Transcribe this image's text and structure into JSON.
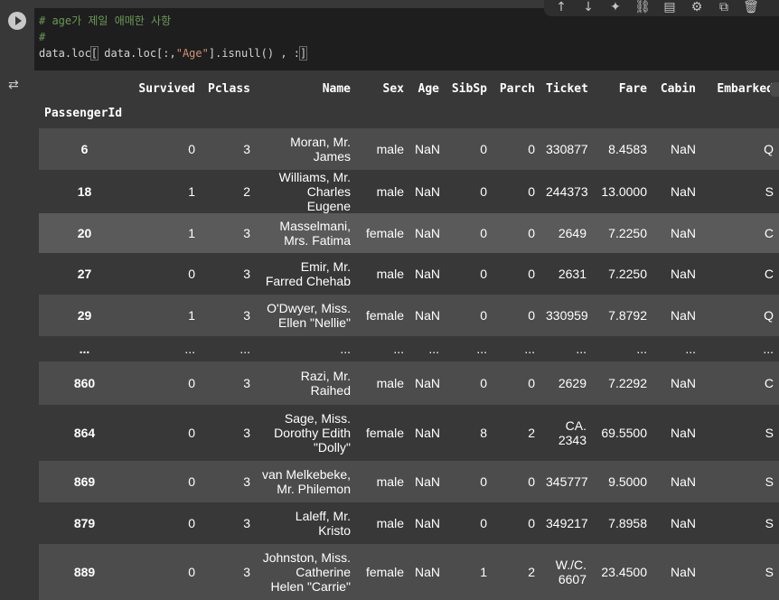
{
  "cell": {
    "code_lines": [
      {
        "comment": "# age가 제일 애매한 사항"
      },
      {
        "comment": "#"
      }
    ],
    "code_parts": {
      "a": "data.loc",
      "b": "[",
      "c": " data.loc[:,",
      "d": "\"Age\"",
      "e": "].isnull()",
      "f": " , :",
      "g": "]"
    }
  },
  "toolbar": {
    "buttons": [
      {
        "name": "move-up-icon",
        "glyph": "↑"
      },
      {
        "name": "move-down-icon",
        "glyph": "↓"
      },
      {
        "name": "gemini-sparkle-icon",
        "glyph": "✦"
      },
      {
        "name": "link-icon",
        "glyph": "⛓"
      },
      {
        "name": "comment-icon",
        "glyph": "▤"
      },
      {
        "name": "gear-icon",
        "glyph": "⚙"
      },
      {
        "name": "open-in-tab-icon",
        "glyph": "⧉"
      },
      {
        "name": "delete-icon",
        "glyph": "🗑"
      }
    ]
  },
  "output": {
    "icon": "output-options-icon",
    "index_name": "PassengerId",
    "columns": [
      "Survived",
      "Pclass",
      "Name",
      "Sex",
      "Age",
      "SibSp",
      "Parch",
      "Ticket",
      "Fare",
      "Cabin",
      "Embarked"
    ],
    "rows": [
      {
        "id": "6",
        "cells": [
          "0",
          "3",
          "Moran, Mr.\nJames",
          "male",
          "NaN",
          "0",
          "0",
          "330877",
          "8.4583",
          "NaN",
          "Q"
        ]
      },
      {
        "id": "18",
        "cells": [
          "1",
          "2",
          "Williams, Mr.\nCharles Eugene",
          "male",
          "NaN",
          "0",
          "0",
          "244373",
          "13.0000",
          "NaN",
          "S"
        ]
      },
      {
        "id": "20",
        "cells": [
          "1",
          "3",
          "Masselmani,\nMrs. Fatima",
          "female",
          "NaN",
          "0",
          "0",
          "2649",
          "7.2250",
          "NaN",
          "C"
        ]
      },
      {
        "id": "27",
        "cells": [
          "0",
          "3",
          "Emir, Mr.\nFarred Chehab",
          "male",
          "NaN",
          "0",
          "0",
          "2631",
          "7.2250",
          "NaN",
          "C"
        ]
      },
      {
        "id": "29",
        "cells": [
          "1",
          "3",
          "O'Dwyer, Miss.\nEllen \"Nellie\"",
          "female",
          "NaN",
          "0",
          "0",
          "330959",
          "7.8792",
          "NaN",
          "Q"
        ]
      },
      {
        "id": "...",
        "cells": [
          "...",
          "...",
          "...",
          "...",
          "...",
          "...",
          "...",
          "...",
          "...",
          "...",
          "..."
        ]
      },
      {
        "id": "860",
        "cells": [
          "0",
          "3",
          "Razi, Mr.\nRaihed",
          "male",
          "NaN",
          "0",
          "0",
          "2629",
          "7.2292",
          "NaN",
          "C"
        ]
      },
      {
        "id": "864",
        "cells": [
          "0",
          "3",
          "Sage, Miss.\nDorothy Edith\n\"Dolly\"",
          "female",
          "NaN",
          "8",
          "2",
          "CA.\n2343",
          "69.5500",
          "NaN",
          "S"
        ]
      },
      {
        "id": "869",
        "cells": [
          "0",
          "3",
          "van Melkebeke,\nMr. Philemon",
          "male",
          "NaN",
          "0",
          "0",
          "345777",
          "9.5000",
          "NaN",
          "S"
        ]
      },
      {
        "id": "879",
        "cells": [
          "0",
          "3",
          "Laleff, Mr.\nKristo",
          "male",
          "NaN",
          "0",
          "0",
          "349217",
          "7.8958",
          "NaN",
          "S"
        ]
      },
      {
        "id": "889",
        "cells": [
          "0",
          "3",
          "Johnston, Miss.\nCatherine\nHelen \"Carrie\"",
          "female",
          "NaN",
          "1",
          "2",
          "W./C.\n6607",
          "23.4500",
          "NaN",
          "S"
        ]
      }
    ]
  }
}
